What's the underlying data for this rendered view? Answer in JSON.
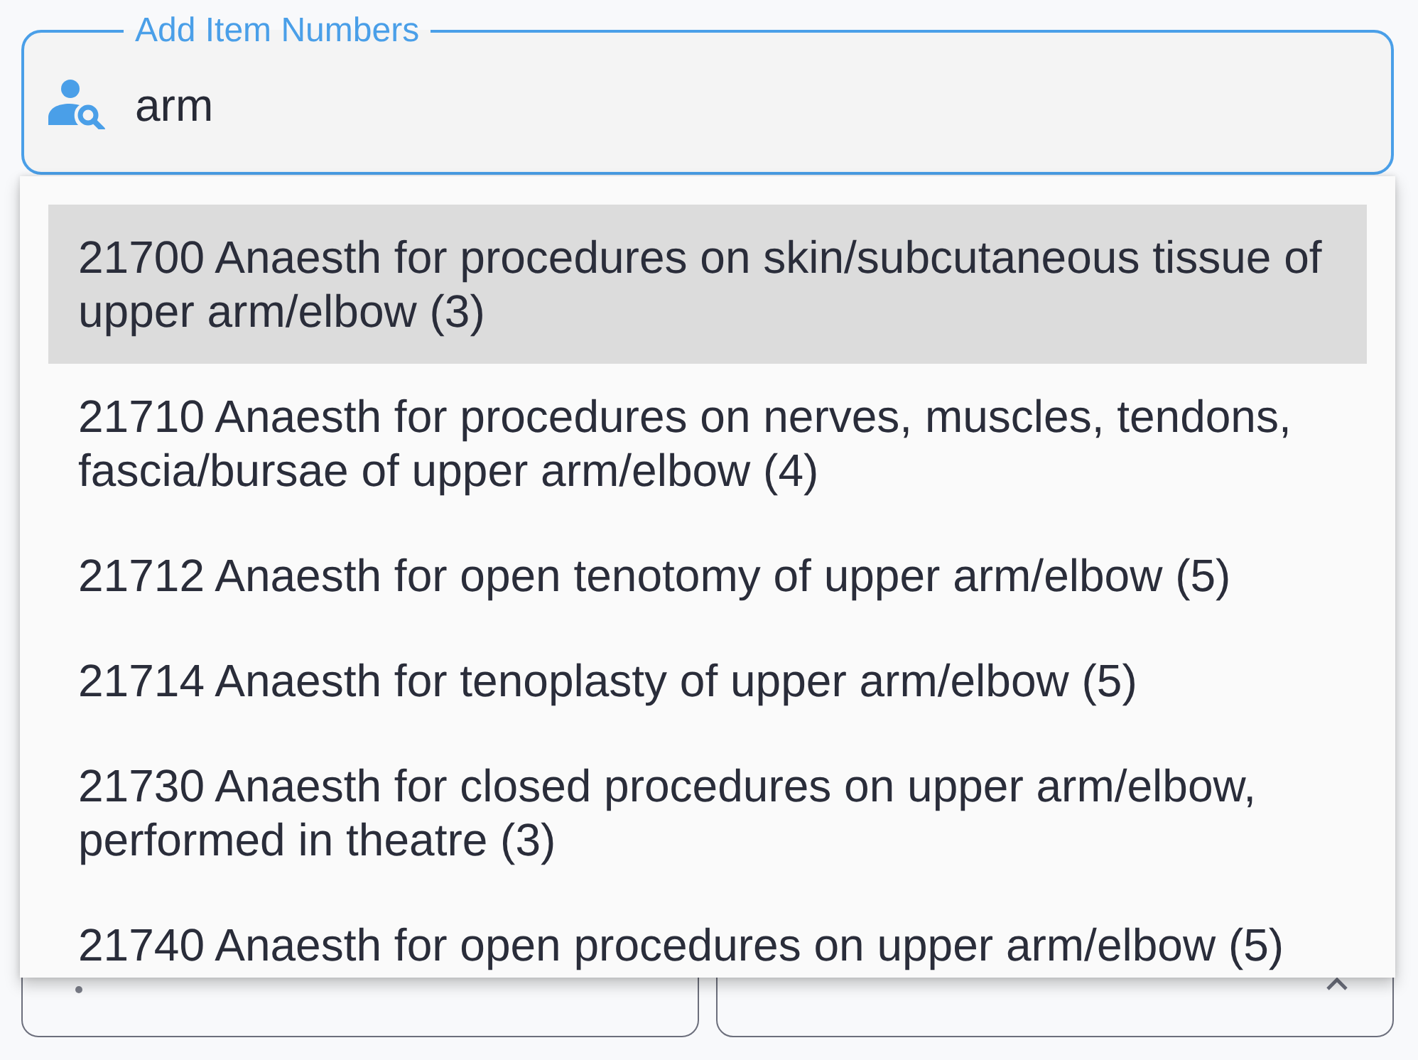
{
  "search": {
    "label": "Add Item Numbers",
    "value": "arm"
  },
  "suggestions": [
    {
      "text": "21700 Anaesth for procedures on skin/subcutaneous tissue of upper arm/elbow (3)",
      "selected": true
    },
    {
      "text": "21710 Anaesth for procedures on nerves, muscles, tendons, fascia/bursae of upper arm/elbow (4)",
      "selected": false
    },
    {
      "text": "21712 Anaesth for open tenotomy of upper arm/elbow (5)",
      "selected": false
    },
    {
      "text": "21714 Anaesth for tenoplasty of upper arm/elbow (5)",
      "selected": false
    },
    {
      "text": "21730 Anaesth for closed procedures on upper arm/elbow, performed in theatre (3)",
      "selected": false
    },
    {
      "text": "21740 Anaesth for open procedures on upper arm/elbow (5)",
      "selected": false
    }
  ]
}
